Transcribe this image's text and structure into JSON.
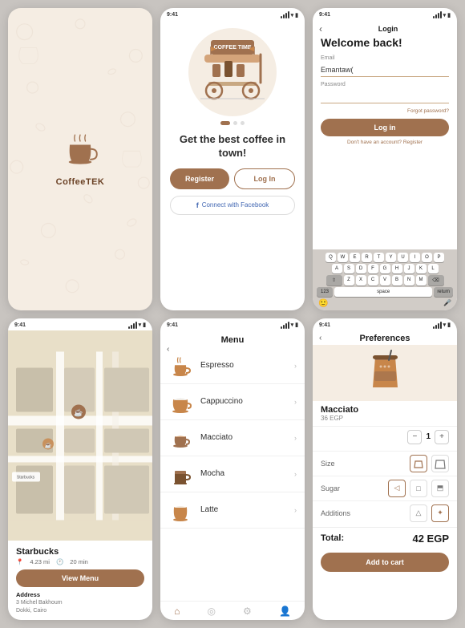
{
  "splash": {
    "logo_text": "CoffeeTEK"
  },
  "onboard": {
    "headline": "Get the best coffee in town!",
    "btn_register": "Register",
    "btn_login": "Log In",
    "btn_facebook": "Connect with Facebook"
  },
  "login": {
    "title": "Login",
    "welcome": "Welcome back!",
    "email_label": "Email",
    "email_value": "Emantaw(",
    "password_label": "Password",
    "forgot": "Forgot password?",
    "btn_login": "Log in",
    "register_prompt": "Don't have an account? Register"
  },
  "map": {
    "store_name": "Starbucks",
    "distance": "4.23 mi",
    "time": "20 min",
    "btn_view": "View Menu",
    "address_label": "Address",
    "address_line1": "3 Michel Bakhoum",
    "address_line2": "Dokki, Cairo"
  },
  "menu": {
    "title": "Menu",
    "items": [
      {
        "name": "Espresso"
      },
      {
        "name": "Cappuccino"
      },
      {
        "name": "Macciato"
      },
      {
        "name": "Mocha"
      },
      {
        "name": "Latte"
      }
    ]
  },
  "preferences": {
    "title": "Preferences",
    "item_name": "Macciato",
    "item_price": "36 EGP",
    "qty": 1,
    "size_label": "Size",
    "sugar_label": "Sugar",
    "additions_label": "Additions",
    "total_label": "Total:",
    "total_price": "42 EGP",
    "btn_cart": "Add to cart"
  },
  "status": {
    "time": "9:41",
    "time2": "9:41",
    "time3": "9:41",
    "time4": "9:41"
  }
}
